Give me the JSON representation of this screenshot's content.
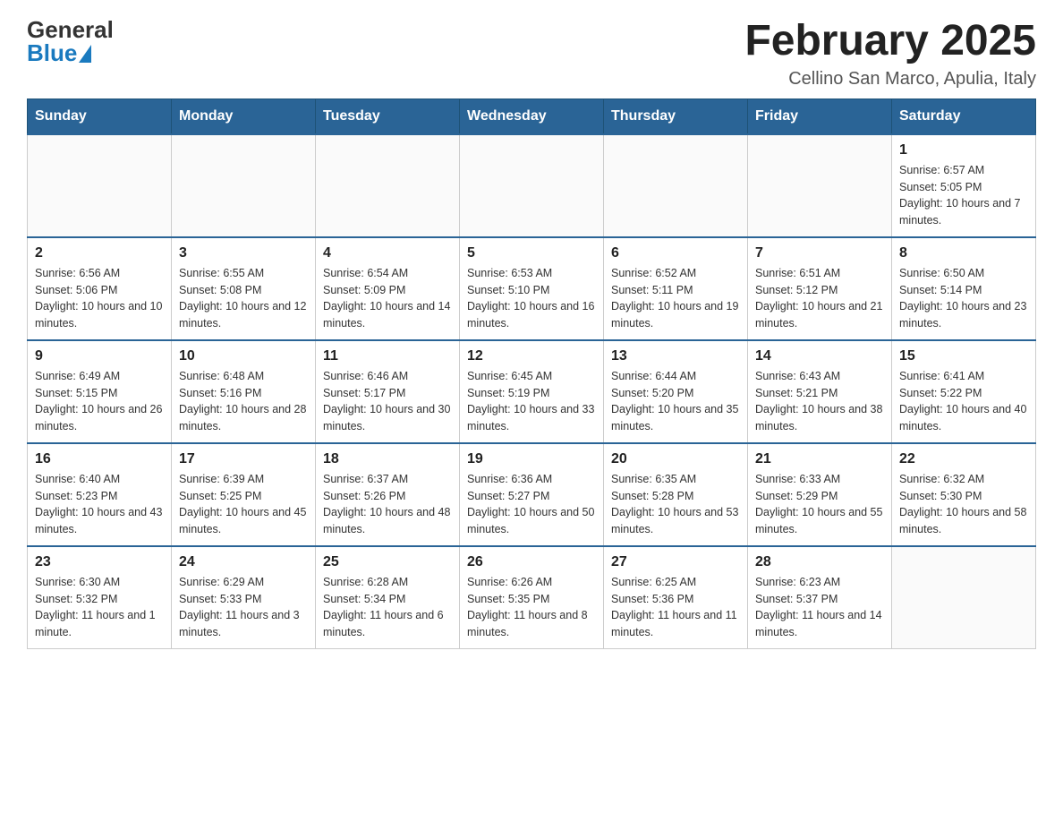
{
  "logo": {
    "general": "General",
    "blue": "Blue"
  },
  "header": {
    "title": "February 2025",
    "subtitle": "Cellino San Marco, Apulia, Italy"
  },
  "weekdays": [
    "Sunday",
    "Monday",
    "Tuesday",
    "Wednesday",
    "Thursday",
    "Friday",
    "Saturday"
  ],
  "weeks": [
    [
      {
        "day": "",
        "sunrise": "",
        "sunset": "",
        "daylight": ""
      },
      {
        "day": "",
        "sunrise": "",
        "sunset": "",
        "daylight": ""
      },
      {
        "day": "",
        "sunrise": "",
        "sunset": "",
        "daylight": ""
      },
      {
        "day": "",
        "sunrise": "",
        "sunset": "",
        "daylight": ""
      },
      {
        "day": "",
        "sunrise": "",
        "sunset": "",
        "daylight": ""
      },
      {
        "day": "",
        "sunrise": "",
        "sunset": "",
        "daylight": ""
      },
      {
        "day": "1",
        "sunrise": "Sunrise: 6:57 AM",
        "sunset": "Sunset: 5:05 PM",
        "daylight": "Daylight: 10 hours and 7 minutes."
      }
    ],
    [
      {
        "day": "2",
        "sunrise": "Sunrise: 6:56 AM",
        "sunset": "Sunset: 5:06 PM",
        "daylight": "Daylight: 10 hours and 10 minutes."
      },
      {
        "day": "3",
        "sunrise": "Sunrise: 6:55 AM",
        "sunset": "Sunset: 5:08 PM",
        "daylight": "Daylight: 10 hours and 12 minutes."
      },
      {
        "day": "4",
        "sunrise": "Sunrise: 6:54 AM",
        "sunset": "Sunset: 5:09 PM",
        "daylight": "Daylight: 10 hours and 14 minutes."
      },
      {
        "day": "5",
        "sunrise": "Sunrise: 6:53 AM",
        "sunset": "Sunset: 5:10 PM",
        "daylight": "Daylight: 10 hours and 16 minutes."
      },
      {
        "day": "6",
        "sunrise": "Sunrise: 6:52 AM",
        "sunset": "Sunset: 5:11 PM",
        "daylight": "Daylight: 10 hours and 19 minutes."
      },
      {
        "day": "7",
        "sunrise": "Sunrise: 6:51 AM",
        "sunset": "Sunset: 5:12 PM",
        "daylight": "Daylight: 10 hours and 21 minutes."
      },
      {
        "day": "8",
        "sunrise": "Sunrise: 6:50 AM",
        "sunset": "Sunset: 5:14 PM",
        "daylight": "Daylight: 10 hours and 23 minutes."
      }
    ],
    [
      {
        "day": "9",
        "sunrise": "Sunrise: 6:49 AM",
        "sunset": "Sunset: 5:15 PM",
        "daylight": "Daylight: 10 hours and 26 minutes."
      },
      {
        "day": "10",
        "sunrise": "Sunrise: 6:48 AM",
        "sunset": "Sunset: 5:16 PM",
        "daylight": "Daylight: 10 hours and 28 minutes."
      },
      {
        "day": "11",
        "sunrise": "Sunrise: 6:46 AM",
        "sunset": "Sunset: 5:17 PM",
        "daylight": "Daylight: 10 hours and 30 minutes."
      },
      {
        "day": "12",
        "sunrise": "Sunrise: 6:45 AM",
        "sunset": "Sunset: 5:19 PM",
        "daylight": "Daylight: 10 hours and 33 minutes."
      },
      {
        "day": "13",
        "sunrise": "Sunrise: 6:44 AM",
        "sunset": "Sunset: 5:20 PM",
        "daylight": "Daylight: 10 hours and 35 minutes."
      },
      {
        "day": "14",
        "sunrise": "Sunrise: 6:43 AM",
        "sunset": "Sunset: 5:21 PM",
        "daylight": "Daylight: 10 hours and 38 minutes."
      },
      {
        "day": "15",
        "sunrise": "Sunrise: 6:41 AM",
        "sunset": "Sunset: 5:22 PM",
        "daylight": "Daylight: 10 hours and 40 minutes."
      }
    ],
    [
      {
        "day": "16",
        "sunrise": "Sunrise: 6:40 AM",
        "sunset": "Sunset: 5:23 PM",
        "daylight": "Daylight: 10 hours and 43 minutes."
      },
      {
        "day": "17",
        "sunrise": "Sunrise: 6:39 AM",
        "sunset": "Sunset: 5:25 PM",
        "daylight": "Daylight: 10 hours and 45 minutes."
      },
      {
        "day": "18",
        "sunrise": "Sunrise: 6:37 AM",
        "sunset": "Sunset: 5:26 PM",
        "daylight": "Daylight: 10 hours and 48 minutes."
      },
      {
        "day": "19",
        "sunrise": "Sunrise: 6:36 AM",
        "sunset": "Sunset: 5:27 PM",
        "daylight": "Daylight: 10 hours and 50 minutes."
      },
      {
        "day": "20",
        "sunrise": "Sunrise: 6:35 AM",
        "sunset": "Sunset: 5:28 PM",
        "daylight": "Daylight: 10 hours and 53 minutes."
      },
      {
        "day": "21",
        "sunrise": "Sunrise: 6:33 AM",
        "sunset": "Sunset: 5:29 PM",
        "daylight": "Daylight: 10 hours and 55 minutes."
      },
      {
        "day": "22",
        "sunrise": "Sunrise: 6:32 AM",
        "sunset": "Sunset: 5:30 PM",
        "daylight": "Daylight: 10 hours and 58 minutes."
      }
    ],
    [
      {
        "day": "23",
        "sunrise": "Sunrise: 6:30 AM",
        "sunset": "Sunset: 5:32 PM",
        "daylight": "Daylight: 11 hours and 1 minute."
      },
      {
        "day": "24",
        "sunrise": "Sunrise: 6:29 AM",
        "sunset": "Sunset: 5:33 PM",
        "daylight": "Daylight: 11 hours and 3 minutes."
      },
      {
        "day": "25",
        "sunrise": "Sunrise: 6:28 AM",
        "sunset": "Sunset: 5:34 PM",
        "daylight": "Daylight: 11 hours and 6 minutes."
      },
      {
        "day": "26",
        "sunrise": "Sunrise: 6:26 AM",
        "sunset": "Sunset: 5:35 PM",
        "daylight": "Daylight: 11 hours and 8 minutes."
      },
      {
        "day": "27",
        "sunrise": "Sunrise: 6:25 AM",
        "sunset": "Sunset: 5:36 PM",
        "daylight": "Daylight: 11 hours and 11 minutes."
      },
      {
        "day": "28",
        "sunrise": "Sunrise: 6:23 AM",
        "sunset": "Sunset: 5:37 PM",
        "daylight": "Daylight: 11 hours and 14 minutes."
      },
      {
        "day": "",
        "sunrise": "",
        "sunset": "",
        "daylight": ""
      }
    ]
  ]
}
